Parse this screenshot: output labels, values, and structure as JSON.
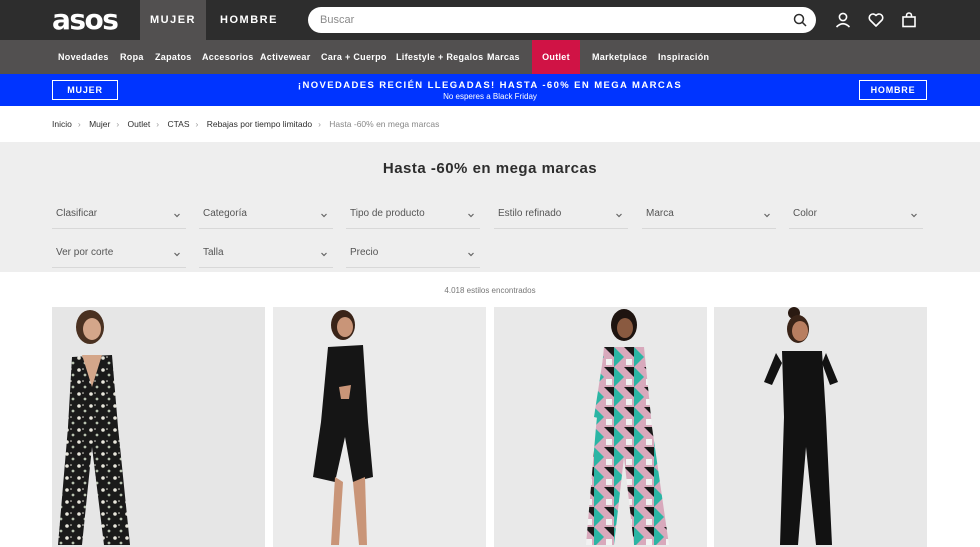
{
  "header": {
    "logo": "asos",
    "tabs": [
      "MUJER",
      "HOMBRE"
    ],
    "search_placeholder": "Buscar"
  },
  "nav": {
    "items": [
      "Novedades",
      "Ropa",
      "Zapatos",
      "Accesorios",
      "Activewear",
      "Cara + Cuerpo",
      "Lifestyle + Regalos",
      "Marcas",
      "Outlet",
      "Marketplace",
      "Inspiración"
    ]
  },
  "promo": {
    "left_button": "MUJER",
    "title": "¡NOVEDADES RECIÉN LLEGADAS! HASTA -60% EN MEGA MARCAS",
    "subtitle": "No esperes a Black Friday",
    "right_button": "HOMBRE"
  },
  "breadcrumb": [
    "Inicio",
    "Mujer",
    "Outlet",
    "CTAS",
    "Rebajas por tiempo limitado",
    "Hasta -60% en mega marcas"
  ],
  "page_title": "Hasta -60% en mega marcas",
  "filters": [
    "Clasificar",
    "Categoría",
    "Tipo de producto",
    "Estilo refinado",
    "Marca",
    "Color",
    "Ver por corte",
    "Talla",
    "Precio"
  ],
  "results_count": "4.018 estilos encontrados",
  "colors": {
    "header_bg": "#2d2d2d",
    "nav_bg": "#525050",
    "outlet_accent": "#d01345",
    "promo_blue": "#0034ff",
    "filter_bg": "#eeeeee"
  },
  "icons": [
    "search-icon",
    "user-icon",
    "heart-icon",
    "bag-icon",
    "chevron-down-icon"
  ]
}
